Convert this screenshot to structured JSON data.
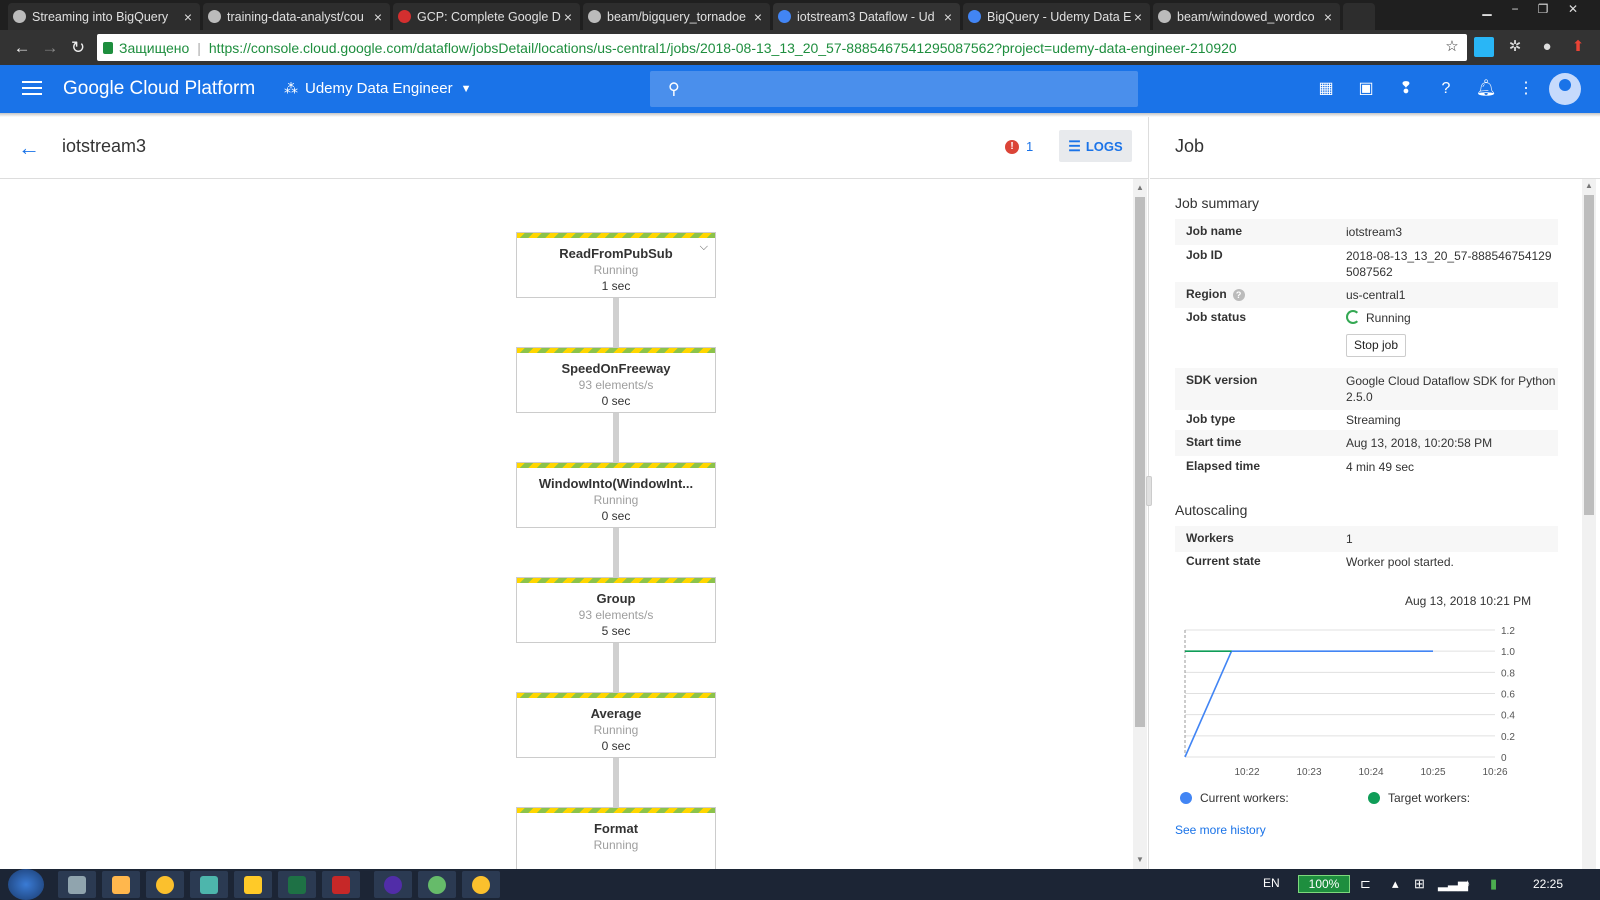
{
  "browser": {
    "tabs": [
      {
        "title": "Streaming into BigQuery",
        "active": false
      },
      {
        "title": "training-data-analyst/cou",
        "active": false
      },
      {
        "title": "GCP: Complete Google D",
        "active": false
      },
      {
        "title": "beam/bigquery_tornadoe",
        "active": false
      },
      {
        "title": "iotstream3 Dataflow - Ud",
        "active": true
      },
      {
        "title": "BigQuery - Udemy Data E",
        "active": false
      },
      {
        "title": "beam/windowed_wordco",
        "active": false
      }
    ],
    "secure_label": "Защищено",
    "url": "https://console.cloud.google.com/dataflow/jobsDetail/locations/us-central1/jobs/2018-08-13_13_20_57-8885467541295087562?project=udemy-data-engineer-210920"
  },
  "appbar": {
    "brand": "Google Cloud Platform",
    "project": "Udemy Data Engineer"
  },
  "job": {
    "title": "iotstream3",
    "error_count": "1",
    "logs_label": "LOGS"
  },
  "graph": {
    "nodes": [
      {
        "name": "ReadFromPubSub",
        "state": "Running",
        "time": "1 sec"
      },
      {
        "name": "SpeedOnFreeway",
        "state": "93 elements/s",
        "time": "0 sec"
      },
      {
        "name": "WindowInto(WindowInt...",
        "state": "Running",
        "time": "0 sec"
      },
      {
        "name": "Group",
        "state": "93 elements/s",
        "time": "5 sec"
      },
      {
        "name": "Average",
        "state": "Running",
        "time": "0 sec"
      },
      {
        "name": "Format",
        "state": "Running",
        "time": ""
      }
    ]
  },
  "panel": {
    "title": "Job",
    "summary_title": "Job summary",
    "rows": [
      {
        "key": "Job name",
        "value": "iotstream3"
      },
      {
        "key": "Job ID",
        "value": "2018-08-13_13_20_57-8885467541295087562"
      },
      {
        "key": "Region",
        "value": "us-central1"
      },
      {
        "key": "Job status",
        "value": "Running"
      },
      {
        "key": "SDK version",
        "value": "Google Cloud Dataflow SDK for Python 2.5.0"
      },
      {
        "key": "Job type",
        "value": "Streaming"
      },
      {
        "key": "Start time",
        "value": "Aug 13, 2018, 10:20:58 PM"
      },
      {
        "key": "Elapsed time",
        "value": "4 min 49 sec"
      }
    ],
    "stop_label": "Stop job",
    "autoscaling_title": "Autoscaling",
    "auto_rows": [
      {
        "key": "Workers",
        "value": "1"
      },
      {
        "key": "Current state",
        "value": "Worker pool started."
      }
    ],
    "chart_time": "Aug 13, 2018 10:21 PM",
    "legend_current": "Current workers:",
    "legend_target": "Target workers:",
    "history_link": "See more history"
  },
  "chart_data": {
    "type": "line",
    "x": [
      "10:22",
      "10:23",
      "10:24",
      "10:25",
      "10:26"
    ],
    "yticks": [
      0,
      0.2,
      0.4,
      0.6,
      0.8,
      1.0,
      1.2
    ],
    "ylim": [
      0,
      1.2
    ],
    "series": [
      {
        "name": "Current workers:",
        "color": "#4285f4",
        "points": [
          [
            "10:21",
            0
          ],
          [
            "10:21.75",
            1
          ],
          [
            "10:25",
            1
          ]
        ]
      },
      {
        "name": "Target workers:",
        "color": "#0f9d58",
        "points": [
          [
            "10:21",
            1
          ],
          [
            "10:21.75",
            1
          ]
        ]
      }
    ]
  },
  "taskbar": {
    "lang": "EN",
    "battery": "100%",
    "clock": "22:25"
  },
  "colors": {
    "appbar": "#1a73e8",
    "link": "#1a73e8",
    "running": "#34a853",
    "error": "#db4437"
  }
}
